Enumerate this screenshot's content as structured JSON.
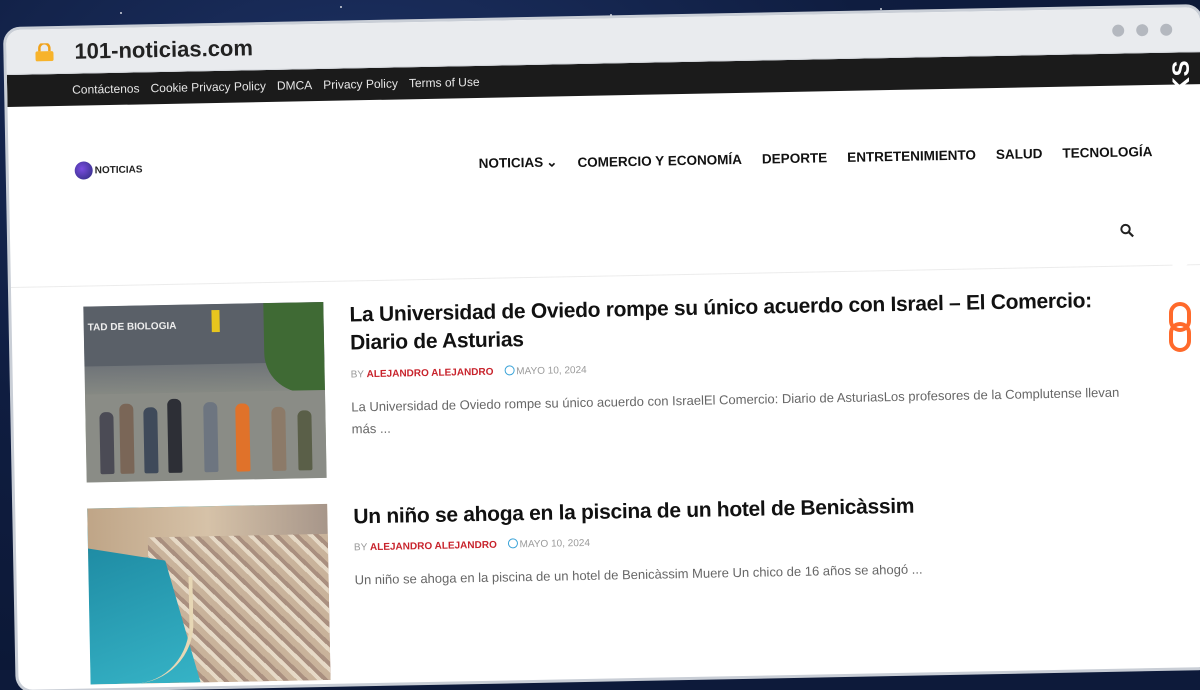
{
  "browser": {
    "url": "101-noticias.com"
  },
  "topbar": {
    "links": [
      "Contáctenos",
      "Cookie Privacy Policy",
      "DMCA",
      "Privacy Policy",
      "Terms of Use"
    ]
  },
  "logo": {
    "text": "NOTICIAS"
  },
  "nav": {
    "items": [
      "NOTICIAS",
      "COMERCIO Y ECONOMÍA",
      "DEPORTE",
      "ENTRETENIMIENTO",
      "SALUD",
      "TECNOLOGÍA"
    ]
  },
  "thumb1": {
    "sign": "TAD DE BIOLOGIA"
  },
  "posts": [
    {
      "title": "La Universidad de Oviedo rompe su único acuerdo con Israel – El Comercio: Diario de Asturias",
      "by": "BY",
      "author": "ALEJANDRO ALEJANDRO",
      "date": "MAYO 10, 2024",
      "excerpt": "La Universidad de Oviedo rompe su único acuerdo con IsraelEl Comercio: Diario de AsturiasLos profesores de la Complutense llevan más ..."
    },
    {
      "title": "Un niño se ahoga en la piscina de un hotel de Benicàssim",
      "by": "BY",
      "author": "ALEJANDRO ALEJANDRO",
      "date": "MAYO 10, 2024",
      "excerpt": "Un niño se ahoga en la piscina de un hotel de Benicàssim Muere Un chico de 16 años se ahogó ..."
    }
  ],
  "badge": {
    "text": "GUESTPOSTLINKS",
    "color": "#ff6a2b"
  },
  "colors": {
    "topbar": "#1b1b1b",
    "author": "#c8232c",
    "date_icon": "#3aa3d8"
  }
}
